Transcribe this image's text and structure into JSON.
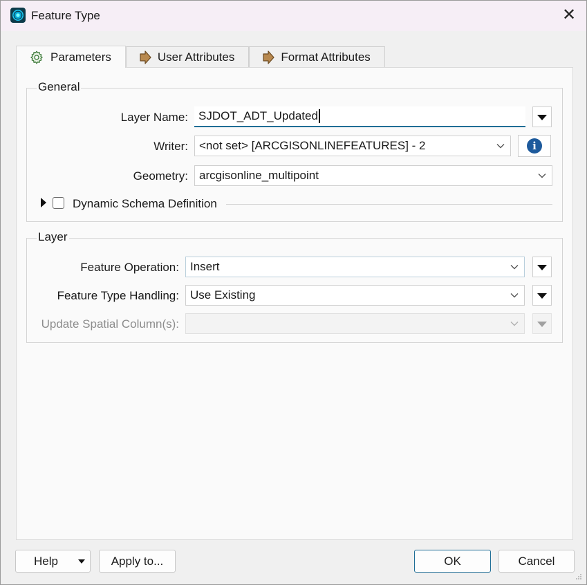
{
  "window": {
    "title": "Feature Type",
    "close_glyph": "✕"
  },
  "tabs": [
    {
      "label": "Parameters",
      "icon": "gear-icon",
      "active": true
    },
    {
      "label": "User Attributes",
      "icon": "arrow-right-icon",
      "active": false
    },
    {
      "label": "Format Attributes",
      "icon": "arrow-right-icon",
      "active": false
    }
  ],
  "general": {
    "group_label": "General",
    "layer_name": {
      "label": "Layer Name:",
      "value": "SJDOT_ADT_Updated"
    },
    "writer": {
      "label": "Writer:",
      "value": "<not set> [ARCGISONLINEFEATURES] - 2",
      "info_icon": "info-icon"
    },
    "geometry": {
      "label": "Geometry:",
      "value": "arcgisonline_multipoint"
    },
    "dynamic_schema": {
      "label": "Dynamic Schema Definition",
      "checked": false
    }
  },
  "layer": {
    "group_label": "Layer",
    "feature_operation": {
      "label": "Feature Operation:",
      "value": "Insert"
    },
    "feature_type_handling": {
      "label": "Feature Type Handling:",
      "value": "Use Existing"
    },
    "update_spatial_columns": {
      "label": "Update Spatial Column(s):",
      "value": "",
      "disabled": true
    }
  },
  "footer": {
    "help_label": "Help",
    "apply_label": "Apply to...",
    "ok_label": "OK",
    "cancel_label": "Cancel"
  },
  "colors": {
    "accent": "#1f6e96",
    "title_bar": "#f6eef6",
    "info_icon": "#1d5a9c"
  }
}
